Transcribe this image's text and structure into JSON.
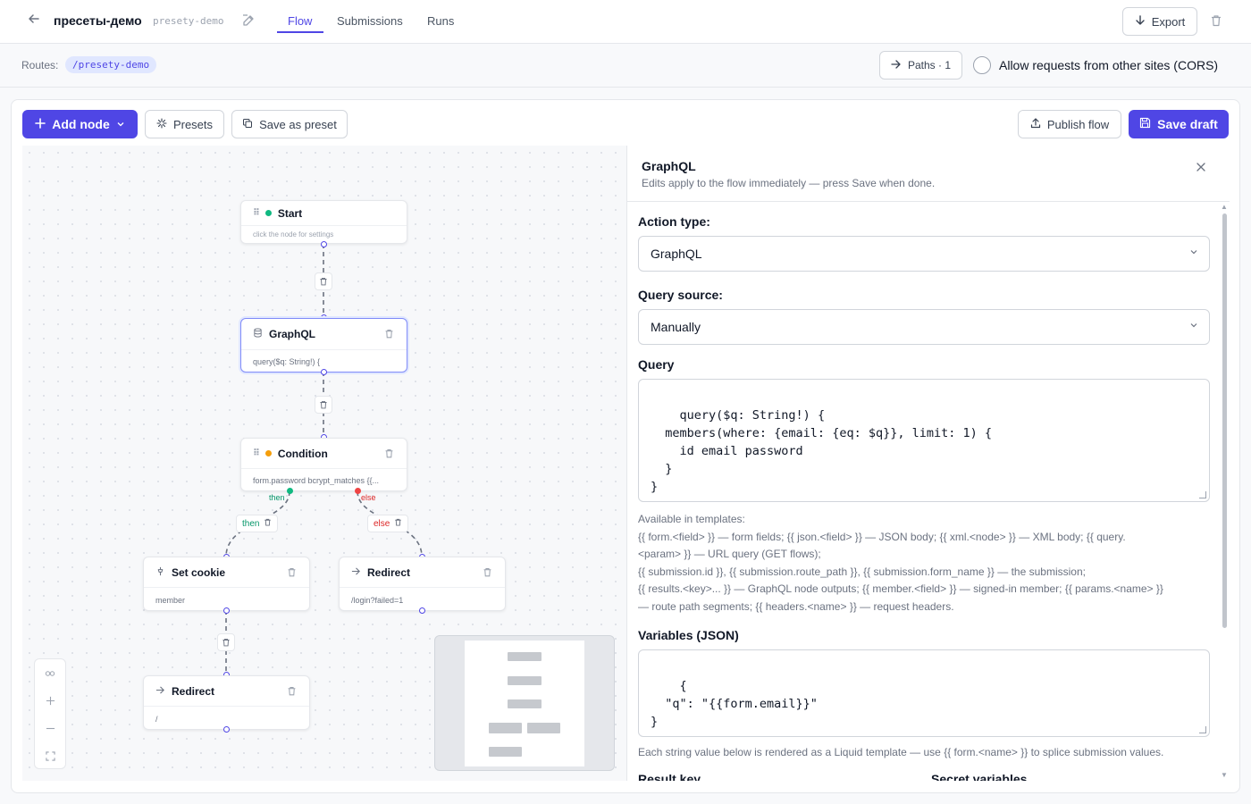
{
  "header": {
    "title": "пресеты-демо",
    "slug": "presety-demo",
    "tabs": [
      {
        "label": "Flow",
        "active": true
      },
      {
        "label": "Submissions",
        "active": false
      },
      {
        "label": "Runs",
        "active": false
      }
    ],
    "export_label": "Export"
  },
  "routes": {
    "label": "Routes:",
    "route": "/presety-demo",
    "paths_label": "Paths · 1",
    "cors_label": "Allow requests from other sites (CORS)",
    "cors_checked": false
  },
  "toolbar": {
    "add_node": "Add node",
    "presets": "Presets",
    "save_as_preset": "Save as preset",
    "publish": "Publish flow",
    "save_draft": "Save draft"
  },
  "colors": {
    "accent": "#4f46e5",
    "start_dot": "#10b981",
    "condition_dot": "#f59e0b",
    "then": "#059669",
    "else": "#dc2626"
  },
  "nodes": {
    "start": {
      "title": "Start",
      "sub": "click the node for settings",
      "icon": "grip-icon"
    },
    "graphql": {
      "title": "GraphQL",
      "sub": "query($q: String!) {",
      "icon": "database-icon"
    },
    "condition": {
      "title": "Condition",
      "sub": "form.password bcrypt_matches {{...",
      "icon": "grip-icon"
    },
    "set_cookie": {
      "title": "Set cookie",
      "sub": "member",
      "icon": "cookie-icon"
    },
    "redirect_fail": {
      "title": "Redirect",
      "sub": "/login?failed=1",
      "icon": "arrow-right-icon"
    },
    "redirect": {
      "title": "Redirect",
      "sub": "/",
      "icon": "arrow-right-icon"
    }
  },
  "branches": {
    "then": "then",
    "else": "else"
  },
  "panel": {
    "title": "GraphQL",
    "subtitle": "Edits apply to the flow immediately — press Save when done.",
    "action_type_label": "Action type:",
    "action_type_value": "GraphQL",
    "query_source_label": "Query source:",
    "query_source_value": "Manually",
    "query_label": "Query",
    "query_value": "query($q: String!) {\n  members(where: {email: {eq: $q}}, limit: 1) {\n    id email password\n  }\n}",
    "templates_title": "Available in templates:",
    "templates_lines": [
      "{{ form.<field> }} — form fields; {{ json.<field> }} — JSON body; {{ xml.<node> }} — XML body; {{ query.",
      "<param> }} — URL query (GET flows);",
      "{{ submission.id }}, {{ submission.route_path }}, {{ submission.form_name }} — the submission;",
      "{{ results.<key>... }} — GraphQL node outputs; {{ member.<field> }} — signed-in member; {{ params.<name> }}",
      "— route path segments; {{ headers.<name> }} — request headers."
    ],
    "variables_label": "Variables (JSON)",
    "variables_value": "{\n  \"q\": \"{{form.email}}\"\n}",
    "liquid_note": "Each string value below is rendered as a Liquid template — use {{ form.<name> }} to splice submission values.",
    "result_key_label": "Result key",
    "secret_vars_label": "Secret variables"
  }
}
